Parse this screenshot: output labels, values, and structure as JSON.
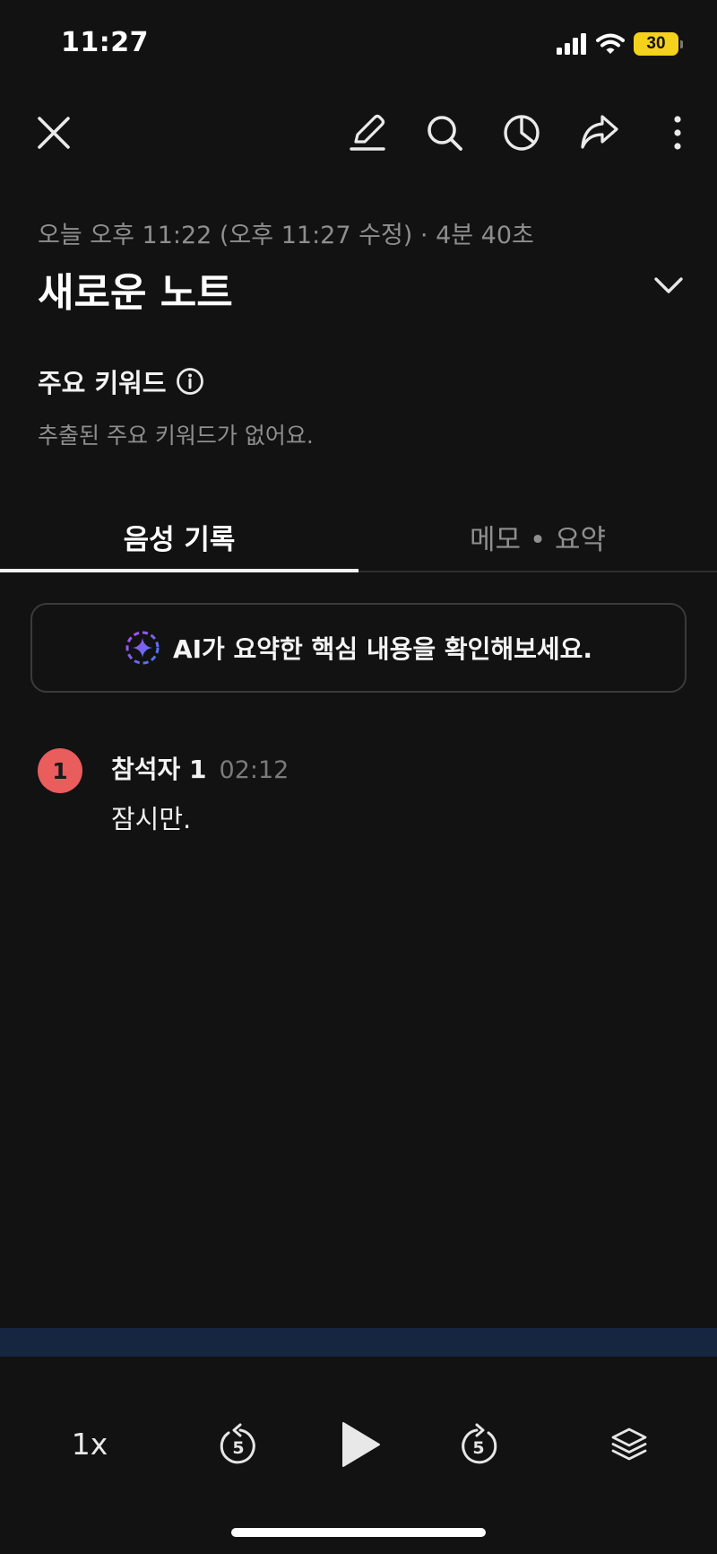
{
  "status_bar": {
    "time": "11:27",
    "battery_level": "30",
    "battery_color": "#f4d11a"
  },
  "toolbar": {
    "icons": [
      "close-icon",
      "edit-pencil-icon",
      "search-icon",
      "pie-chart-icon",
      "share-arrow-icon",
      "more-vertical-icon"
    ]
  },
  "note": {
    "meta": "오늘 오후 11:22 (오후 11:27 수정) · 4분 40초",
    "title": "새로운 노트"
  },
  "keywords": {
    "heading": "주요 키워드",
    "empty_text": "추출된 주요 키워드가 없어요."
  },
  "tabs": [
    {
      "label": "음성 기록",
      "active": true
    },
    {
      "label": "메모 • 요약",
      "active": false
    }
  ],
  "ai_banner": {
    "text": "AI가 요약한 핵심 내용을 확인해보세요."
  },
  "transcript": [
    {
      "avatar_number": "1",
      "avatar_color": "#e95d5d",
      "speaker": "참석자 1",
      "time": "02:12",
      "text": "잠시만."
    }
  ],
  "player": {
    "speed": "1x",
    "rewind_seconds": "5",
    "forward_seconds": "5"
  },
  "colors": {
    "background": "#121212",
    "progress_strip": "#172640"
  }
}
